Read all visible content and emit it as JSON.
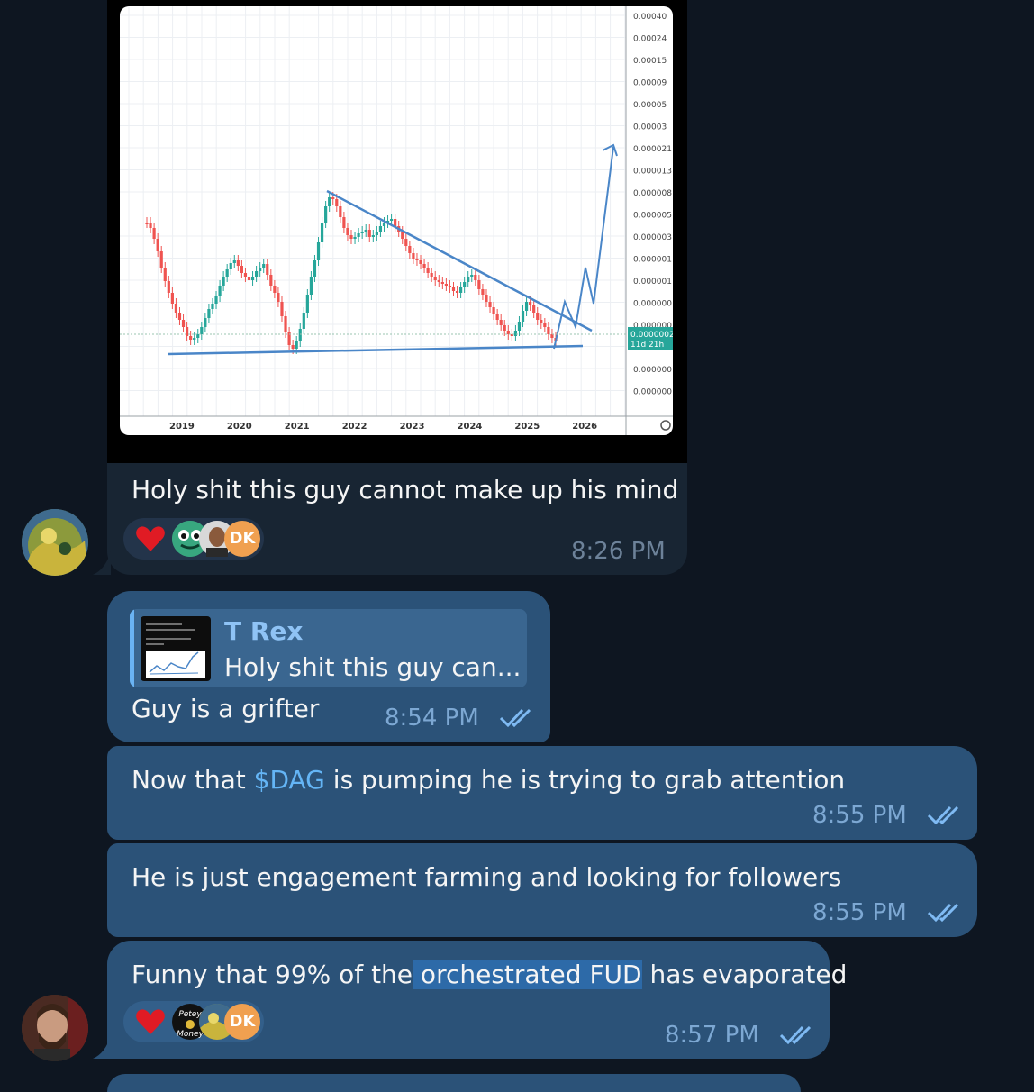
{
  "chart_card": {
    "x_ticks": [
      "2019",
      "2020",
      "2021",
      "2022",
      "2023",
      "2024",
      "2025",
      "2026"
    ],
    "y_ticks": [
      "0.00040",
      "0.00024",
      "0.00015",
      "0.00009",
      "0.00005",
      "0.00003",
      "0.000021",
      "0.000013",
      "0.000008",
      "0.000005",
      "0.000003",
      "0.000001",
      "0.000001",
      "0.000000",
      "0.000000",
      "0.0000002",
      "0.000000",
      "0.000000"
    ],
    "price_tag": "0.0000002",
    "countdown": "11d 21h"
  },
  "messages": [
    {
      "text": "Holy shit this guy cannot make up his mind",
      "time": "8:26 PM",
      "reactions": [
        "heart",
        "frog",
        "face",
        "DK"
      ]
    },
    {
      "reply_author": "T Rex",
      "reply_preview": "Holy shit this guy can...",
      "text": "Guy is a grifter",
      "time": "8:54 PM"
    },
    {
      "text_pre": "Now that ",
      "link": "$DAG",
      "text_post": " is pumping he is trying to grab attention",
      "time": "8:55 PM"
    },
    {
      "text": "He is just engagement farming and looking for followers",
      "time": "8:55 PM"
    },
    {
      "text_pre": "Funny that 99% of the",
      "text_highlight": " orchestrated FUD",
      "text_post": " has evaporated",
      "time": "8:57 PM",
      "reactions": [
        "heart",
        "Petey Money",
        "yellow",
        "DK"
      ]
    }
  ],
  "reaction_labels": {
    "dk": "DK",
    "petey": "Petey",
    "money": "Money"
  }
}
